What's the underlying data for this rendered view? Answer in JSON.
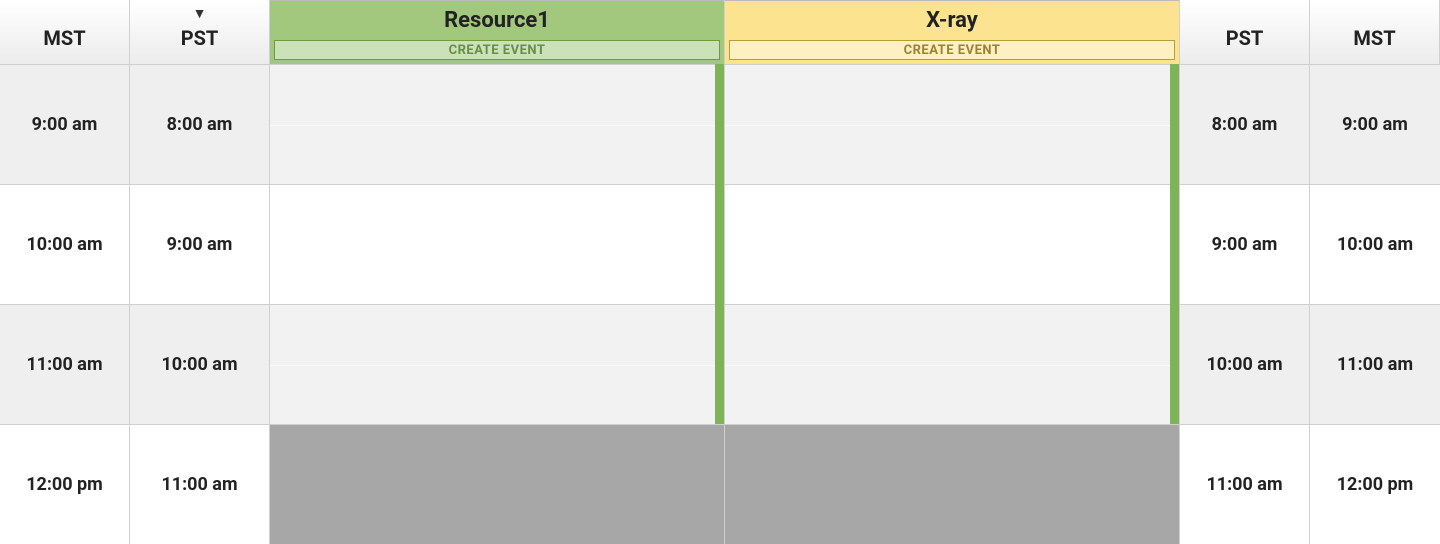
{
  "timezones": {
    "left_outer": "MST",
    "left_inner": "PST",
    "right_inner": "PST",
    "right_outer": "MST"
  },
  "resources": [
    {
      "name": "Resource1",
      "create_label": "CREATE EVENT",
      "color": "green"
    },
    {
      "name": "X-ray",
      "create_label": "CREATE EVENT",
      "color": "yellow"
    }
  ],
  "rows": [
    {
      "mst": "9:00 am",
      "pst": "8:00 am",
      "shade": "alt",
      "blocked": false
    },
    {
      "mst": "10:00 am",
      "pst": "9:00 am",
      "shade": "plain",
      "blocked": false
    },
    {
      "mst": "11:00 am",
      "pst": "10:00 am",
      "shade": "alt",
      "blocked": false
    },
    {
      "mst": "12:00 pm",
      "pst": "11:00 am",
      "shade": "plain",
      "blocked": true
    }
  ],
  "stripe_rows": 3,
  "colors": {
    "green_header": "#a1c87d",
    "yellow_header": "#fbe38f",
    "stripe": "#7fb358",
    "blocked": "#a7a7a7"
  }
}
